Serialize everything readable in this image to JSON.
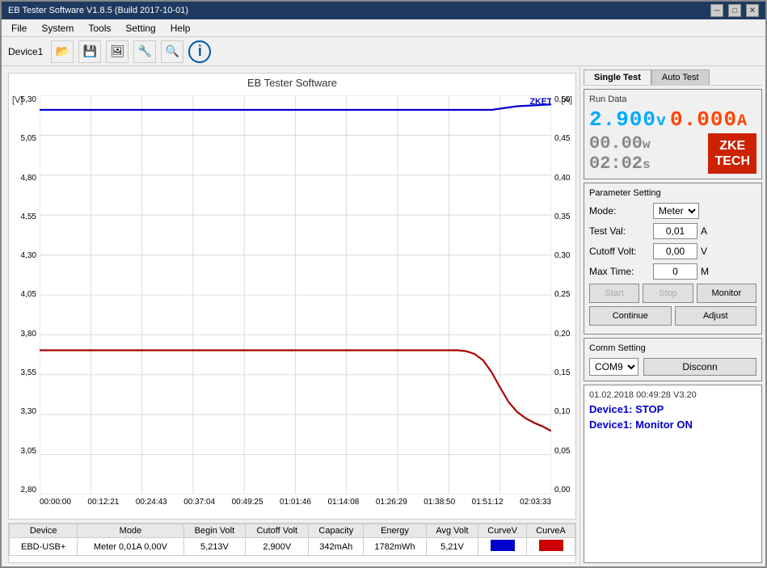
{
  "window": {
    "title": "EB Tester Software V1.8.5 (Build 2017-10-01)"
  },
  "menu": {
    "items": [
      "File",
      "System",
      "Tools",
      "Setting",
      "Help"
    ]
  },
  "toolbar": {
    "device_label": "Device1"
  },
  "chart": {
    "title": "EB Tester Software",
    "unit_left": "[V]",
    "unit_right": "[A]",
    "y_left": [
      "5,30",
      "5,05",
      "4,80",
      "4,55",
      "4,30",
      "4,05",
      "3,80",
      "3,55",
      "3,30",
      "3,05",
      "2,80"
    ],
    "y_right": [
      "0,50",
      "0,45",
      "0,40",
      "0,35",
      "0,30",
      "0,25",
      "0,20",
      "0,15",
      "0,10",
      "0,05",
      "0,00"
    ],
    "x_axis": [
      "00:00:00",
      "00:12:21",
      "00:24:43",
      "00:37:04",
      "00:49:25",
      "01:01:46",
      "01:14:08",
      "01:26:29",
      "01:38:50",
      "01:51:12",
      "02:03:33"
    ]
  },
  "tabs": {
    "single_test": "Single Test",
    "auto_test": "Auto Test"
  },
  "run_data": {
    "label": "Run Data",
    "voltage": "2.900",
    "voltage_unit": "v",
    "current": "0.000",
    "current_unit": "A",
    "watt": "00.00",
    "watt_unit": "w",
    "time": "02:02",
    "time_unit": "s"
  },
  "zke": {
    "line1": "ZKE",
    "line2": "TECH"
  },
  "params": {
    "label": "Parameter Setting",
    "mode_label": "Mode:",
    "mode_value": "Meter",
    "test_val_label": "Test Val:",
    "test_val_value": "0,01",
    "test_val_unit": "A",
    "cutoff_volt_label": "Cutoff Volt:",
    "cutoff_volt_value": "0,00",
    "cutoff_volt_unit": "V",
    "max_time_label": "Max Time:",
    "max_time_value": "0",
    "max_time_unit": "M"
  },
  "controls": {
    "start": "Start",
    "stop": "Stop",
    "monitor": "Monitor",
    "continue": "Continue",
    "adjust": "Adjust"
  },
  "comm": {
    "label": "Comm Setting",
    "port": "COM9",
    "disconnect": "Disconn"
  },
  "status": {
    "line1": "01.02.2018 00:49:28  V3.20",
    "line2": "Device1: STOP",
    "line3": "Device1: Monitor ON"
  },
  "table": {
    "headers": [
      "Device",
      "Mode",
      "Begin Volt",
      "Cutoff Volt",
      "Capacity",
      "Energy",
      "Avg Volt",
      "CurveV",
      "CurveA"
    ],
    "rows": [
      [
        "EBD-USB+",
        "Meter 0,01A 0,00V",
        "5,213V",
        "2,900V",
        "342mAh",
        "1782mWh",
        "5,21V",
        "[blue]",
        "[red]"
      ]
    ]
  }
}
